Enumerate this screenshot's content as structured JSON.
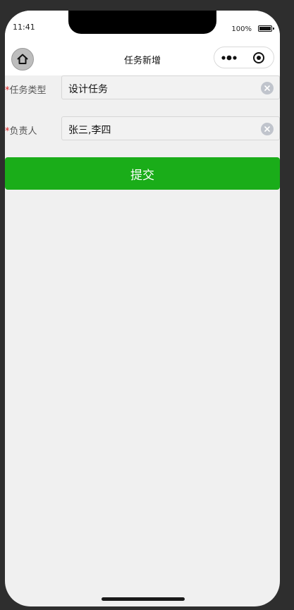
{
  "status_bar": {
    "time": "11:41",
    "battery_percent": "100%",
    "battery_level": 1.0
  },
  "nav": {
    "title": "任务新增",
    "home_icon": "home-icon",
    "more_icon": "more-dots-icon",
    "close_icon": "target-circle-icon"
  },
  "form": {
    "required_mark": "*",
    "task_type": {
      "label": "任务类型",
      "value": "设计任务"
    },
    "assignee": {
      "label": "负责人",
      "value": "张三,李四"
    },
    "submit_label": "提交"
  },
  "colors": {
    "primary": "#1aad19",
    "required": "#e02020",
    "background": "#f0f0f0"
  }
}
